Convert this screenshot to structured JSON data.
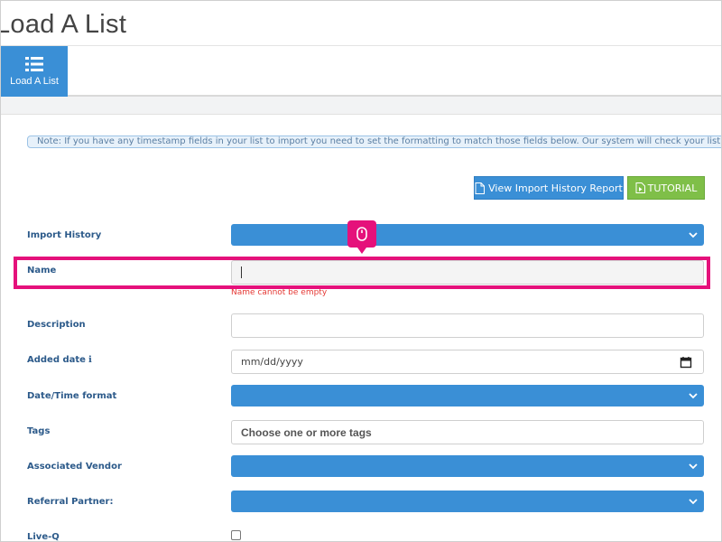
{
  "page": {
    "title": "Load A List"
  },
  "tabs": [
    {
      "label": "Load A List",
      "icon": "list-icon",
      "active": true
    }
  ],
  "note": {
    "text": "Note: If you have any timestamp fields in your list to import you need to set the formatting to match those fields below. Our system will check your list to m"
  },
  "actions": {
    "view_history_label": "View Import History Report",
    "tutorial_label": "TUTORIAL"
  },
  "form": {
    "import_history": {
      "label": "Import History",
      "value": ""
    },
    "name": {
      "label": "Name",
      "value": "",
      "error": "Name cannot be empty"
    },
    "description": {
      "label": "Description",
      "value": ""
    },
    "added_date": {
      "label": "Added date",
      "placeholder": "mm/dd/yyyy"
    },
    "datetime_format": {
      "label": "Date/Time format",
      "value": ""
    },
    "tags": {
      "label": "Tags",
      "placeholder": "Choose one or more tags"
    },
    "associated_vendor": {
      "label": "Associated Vendor",
      "value": ""
    },
    "referral_partner": {
      "label": "Referral Partner:",
      "value": ""
    },
    "live_q": {
      "label": "Live-Q",
      "checked": false
    }
  },
  "colors": {
    "primary": "#3a8fd6",
    "success": "#7fbf48",
    "highlight": "#e5117b",
    "error": "#e53935",
    "label": "#2c5a8a"
  }
}
